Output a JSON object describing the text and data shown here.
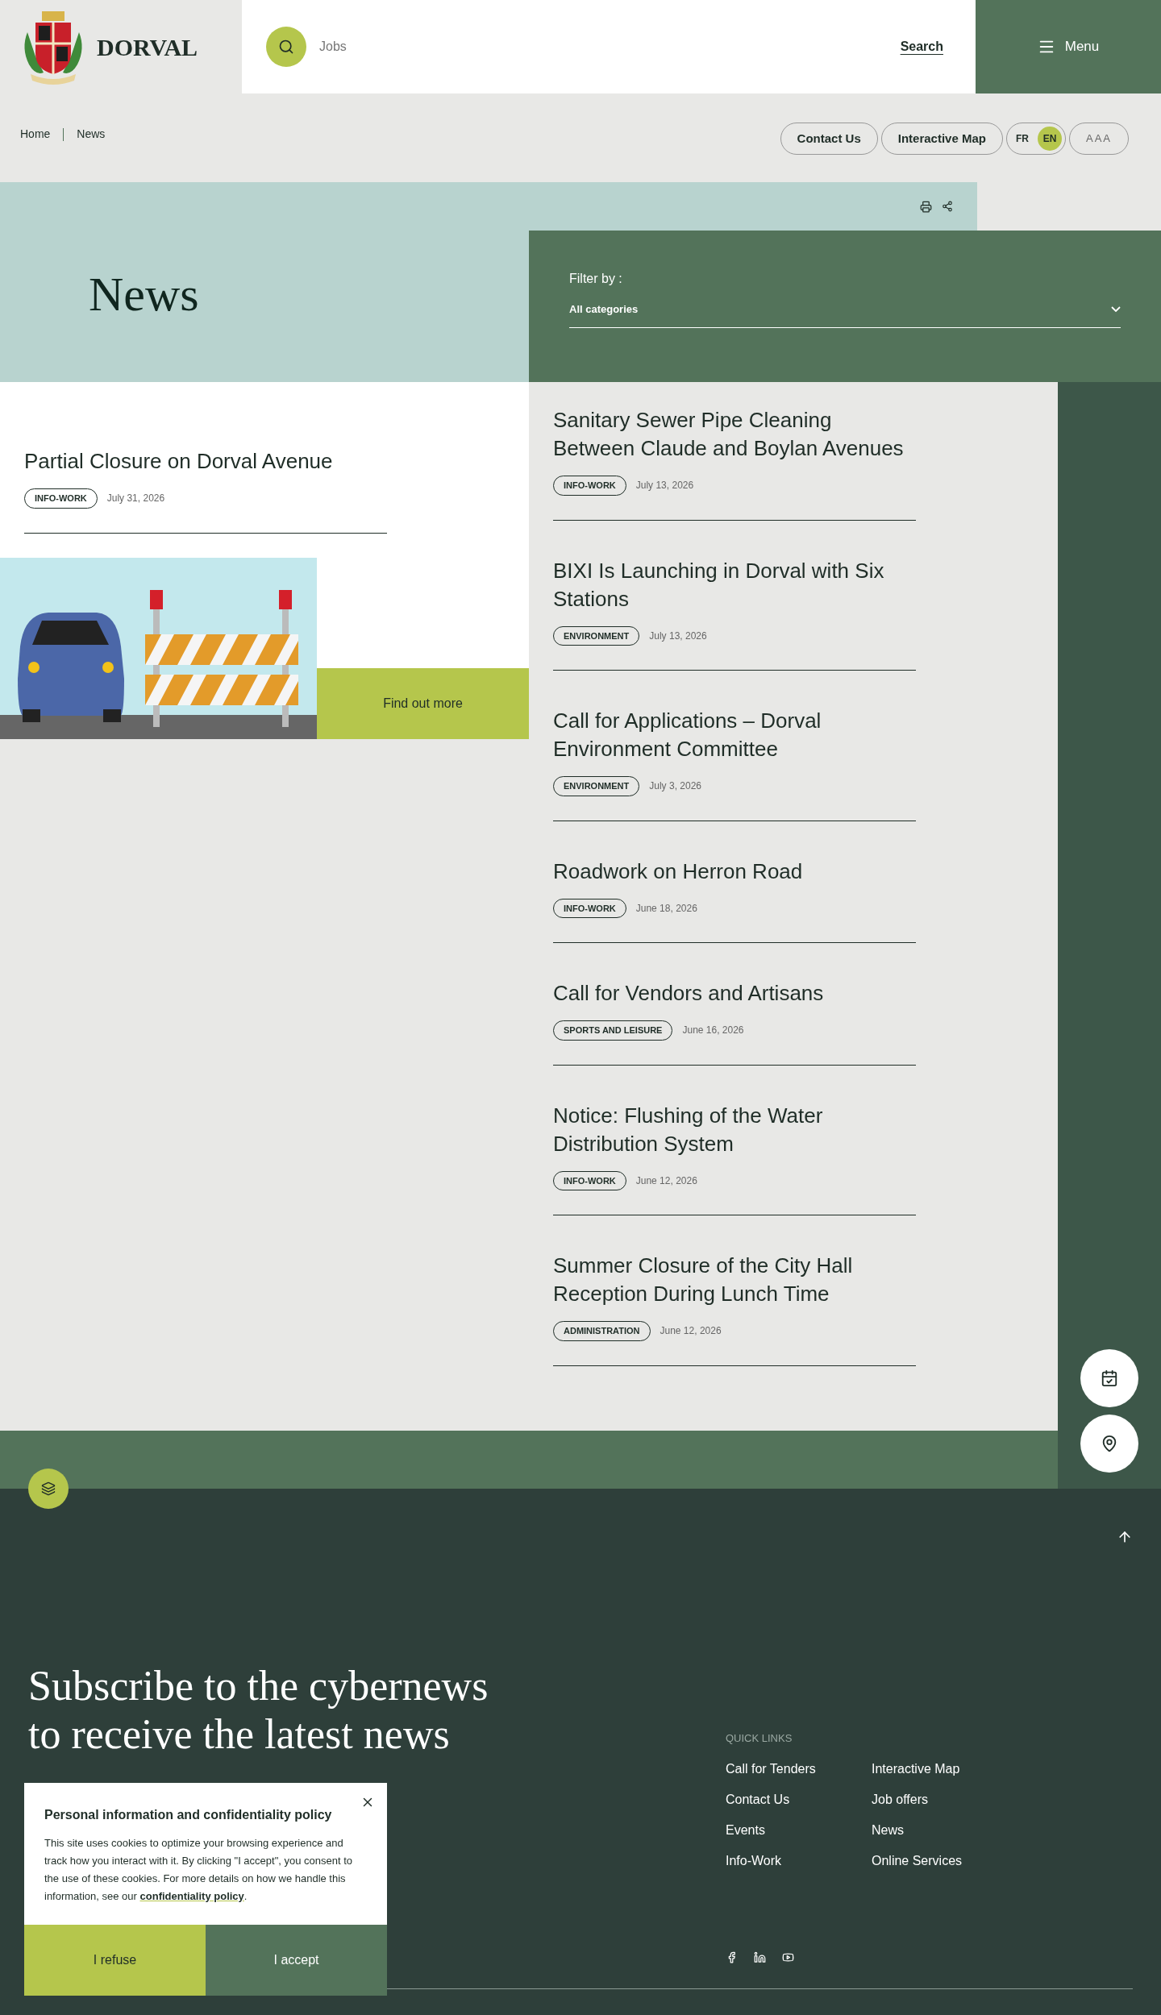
{
  "header": {
    "logo_text": "DORVAL",
    "search": {
      "placeholder": "Jobs"
    },
    "search_link": "Search",
    "menu": "Menu"
  },
  "breadcrumb": [
    "Home",
    "News"
  ],
  "utility": {
    "buttons": [
      "Contact Us",
      "Interactive Map"
    ],
    "languages": [
      {
        "label": "FR",
        "selected": false
      },
      {
        "label": "EN",
        "selected": true
      }
    ],
    "text_size": "AAA"
  },
  "page_title": "News",
  "filter": {
    "label": "Filter by :",
    "value": "All categories"
  },
  "featured": {
    "title": "Partial Closure on Dorval Avenue",
    "tag": "INFO-WORK",
    "date": "July 31, 2026",
    "button": "Find out more"
  },
  "articles": [
    {
      "title": "Sanitary Sewer Pipe Cleaning Between Claude and Boylan Avenues",
      "tag": "INFO-WORK",
      "date": "July 13, 2026"
    },
    {
      "title": "BIXI Is Launching in Dorval with Six Stations",
      "tag": "ENVIRONMENT",
      "date": "July 13, 2026"
    },
    {
      "title": "Call for Applications – Dorval Environment Committee",
      "tag": "ENVIRONMENT",
      "date": "July 3, 2026"
    },
    {
      "title": "Roadwork on Herron Road",
      "tag": "INFO-WORK",
      "date": "June 18, 2026"
    },
    {
      "title": "Call for Vendors and Artisans",
      "tag": "SPORTS AND LEISURE",
      "date": "June 16, 2026"
    },
    {
      "title": "Notice: Flushing of the Water Distribution System",
      "tag": "INFO-WORK",
      "date": "June 12, 2026"
    },
    {
      "title": "Summer Closure of the City Hall Reception During Lunch Time",
      "tag": "ADMINISTRATION",
      "date": "June 12, 2026"
    }
  ],
  "footer": {
    "subscribe_lines": [
      "Subscribe to the cybernews",
      "to receive the latest news"
    ],
    "quick_links_title": "QUICK LINKS",
    "quick_links": [
      "Call for Tenders",
      "Interactive Map",
      "Contact Us",
      "Job offers",
      "Events",
      "News",
      "Info-Work",
      "Online Services"
    ]
  },
  "cookie": {
    "title": "Personal information and confidentiality policy",
    "text": "This site uses cookies to optimize your browsing experience and track how you interact with it. By clicking \"I accept\", you consent to the use of these cookies. For more details on how we handle this information, see our ",
    "link": "confidentiality policy",
    "text_end": ".",
    "refuse": "I refuse",
    "accept": "I accept"
  }
}
